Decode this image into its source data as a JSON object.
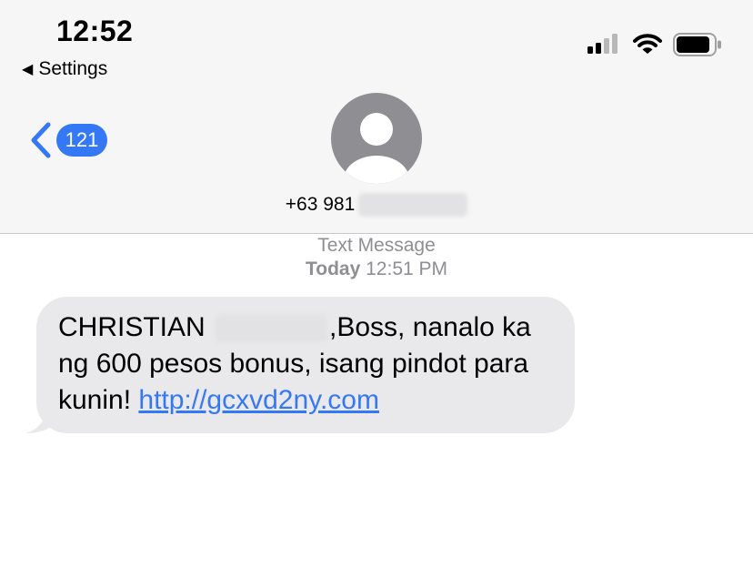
{
  "status_bar": {
    "time": "12:52",
    "back_label": "Settings"
  },
  "nav": {
    "back_count": "121"
  },
  "contact": {
    "number_prefix": "+63 981"
  },
  "thread": {
    "service": "Text Message",
    "day": "Today",
    "time": "12:51 PM"
  },
  "message": {
    "name": "CHRISTIAN",
    "text_after_name": ",Boss, nanalo ka ng 600 pesos bonus, isang pindot para kunin! ",
    "link": "http://gcxvd2ny.com"
  },
  "colors": {
    "accent": "#3478f6",
    "bubble": "#e9e9eb",
    "header_bg": "#f6f6f6",
    "meta_text": "#8e8e93"
  },
  "icons": [
    "signal-icon",
    "wifi-icon",
    "battery-icon",
    "back-chevron-icon",
    "person-avatar-icon"
  ]
}
